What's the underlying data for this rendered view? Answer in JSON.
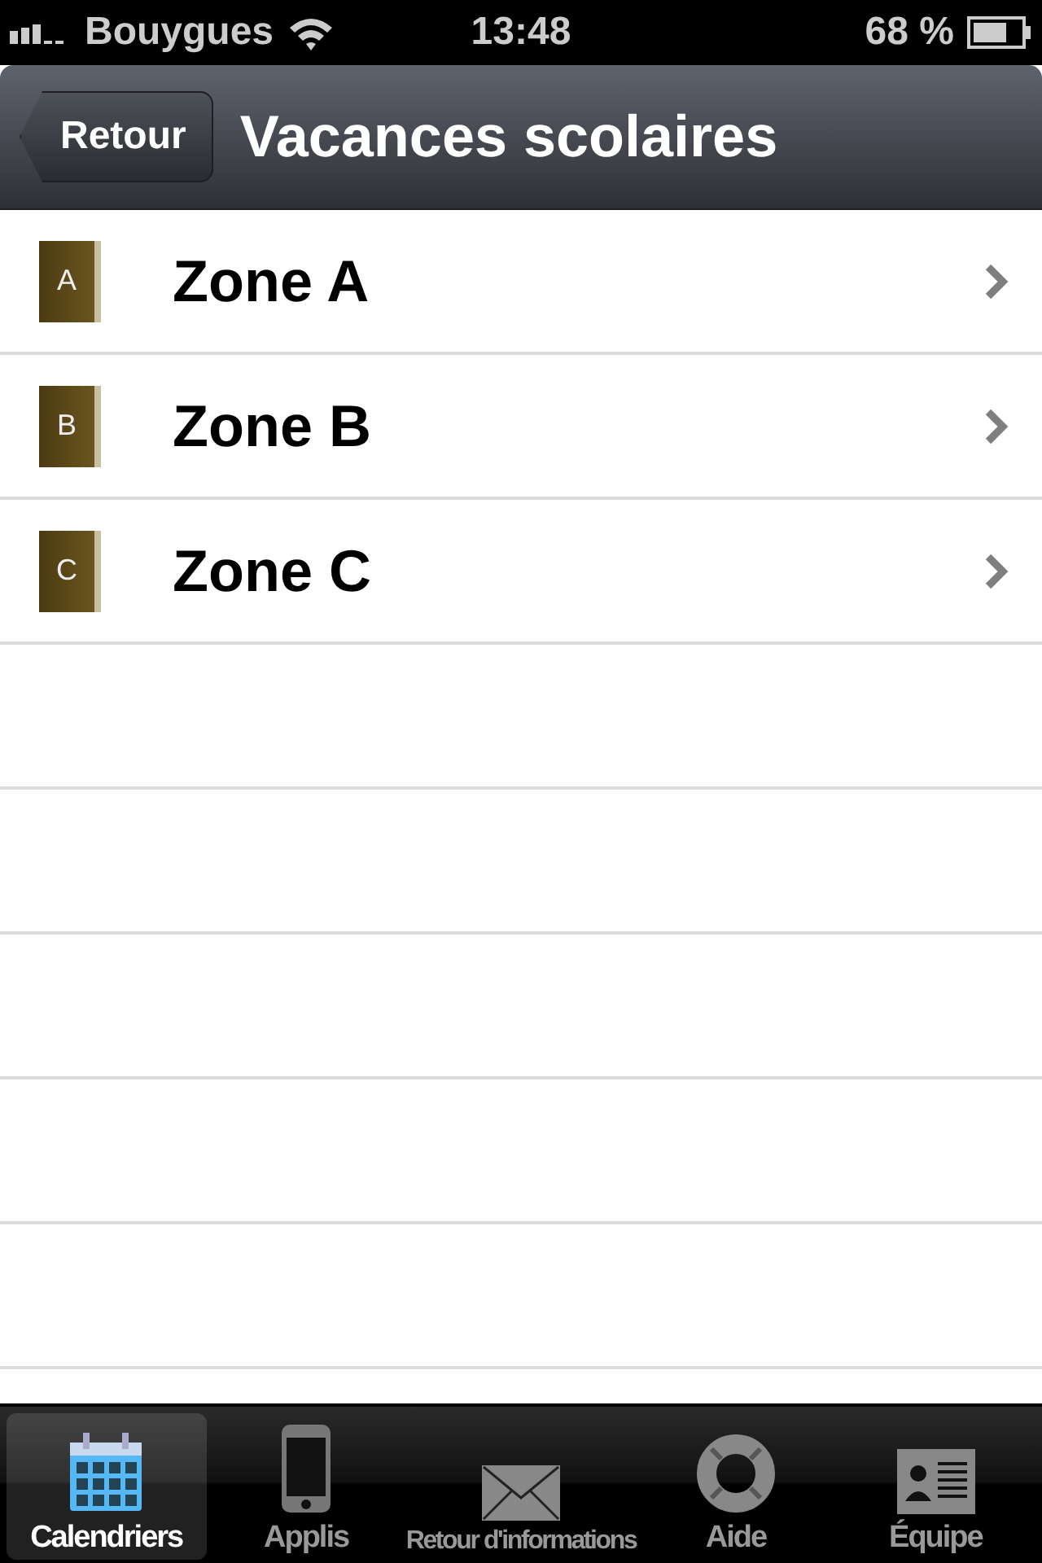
{
  "status_bar": {
    "carrier": "Bouygues",
    "time": "13:48",
    "battery": "68 %"
  },
  "nav_bar": {
    "back": "Retour",
    "title": "Vacances scolaires"
  },
  "rows": [
    {
      "letter": "A",
      "label": "Zone A"
    },
    {
      "letter": "B",
      "label": "Zone B"
    },
    {
      "letter": "C",
      "label": "Zone C"
    }
  ],
  "tabs": [
    {
      "kind": "calendar",
      "label": "Calendriers",
      "selected": true
    },
    {
      "kind": "phone",
      "label": "Applis",
      "selected": false
    },
    {
      "kind": "mail",
      "label": "Retour d'informations",
      "selected": false
    },
    {
      "kind": "help",
      "label": "Aide",
      "selected": false
    },
    {
      "kind": "card",
      "label": "Équipe",
      "selected": false
    }
  ]
}
